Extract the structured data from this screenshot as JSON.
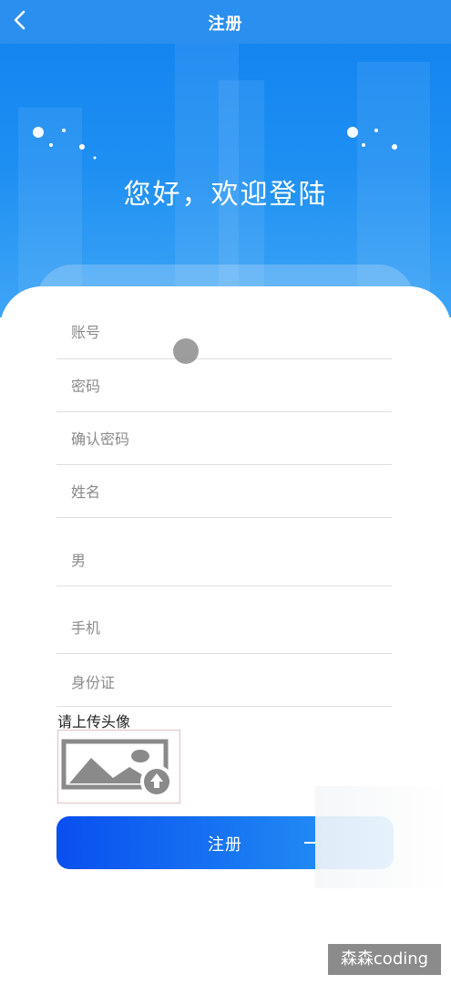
{
  "header": {
    "title": "注册"
  },
  "hero": {
    "welcome": "您好，欢迎登陆"
  },
  "form": {
    "fields": [
      {
        "placeholder": "账号"
      },
      {
        "placeholder": "密码"
      },
      {
        "placeholder": "确认密码"
      },
      {
        "placeholder": "姓名"
      },
      {
        "value": "男"
      },
      {
        "placeholder": "手机"
      },
      {
        "placeholder": "身份证"
      }
    ],
    "avatar_label": "请上传头像",
    "submit_label": "注册"
  },
  "watermark": "森森coding",
  "colors": {
    "topbar": "#2a8fee",
    "hero_top": "#1485f0",
    "button_start": "#0a4ff0",
    "button_end": "#2a99f6"
  },
  "icons": [
    "back-arrow-icon",
    "image-upload-icon",
    "upload-arrow-icon"
  ]
}
